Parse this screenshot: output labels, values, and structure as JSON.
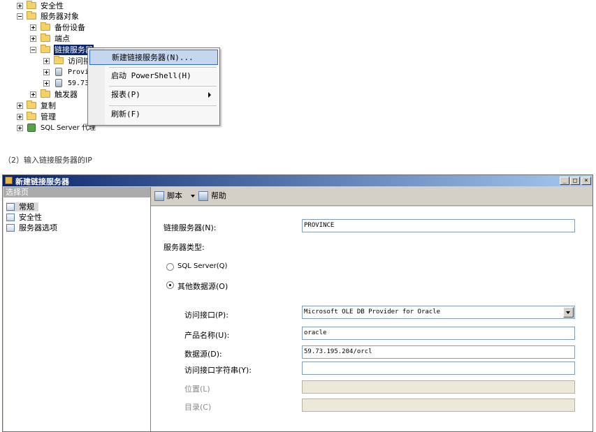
{
  "tree": {
    "security": "安全性",
    "server_objects": "服务器对象",
    "backup_devices": "备份设备",
    "endpoints": "端点",
    "linked_servers": "链接服务器",
    "providers": "访问接",
    "linked_province": "Provi",
    "linked_ip": "59.73",
    "triggers": "触发器",
    "replication": "复制",
    "management": "管理",
    "sql_agent": "SQL Server 代理"
  },
  "context_menu": {
    "items": [
      "新建链接服务器(N)...",
      "启动 PowerShell(H)",
      "报表(P)",
      "刷新(F)"
    ]
  },
  "caption": "（2）输入链接服务器的IP",
  "dialog": {
    "title": "新建链接服务器",
    "window_buttons": [
      "_",
      "□",
      "×"
    ],
    "left_header": "选择页",
    "pages": [
      "常规",
      "安全性",
      "服务器选项"
    ],
    "toolbar": {
      "script": "脚本",
      "help": "帮助"
    },
    "form": {
      "linked_server_label": "链接服务器(N):",
      "linked_server_value": "PROVINCE",
      "server_type_label": "服务器类型:",
      "sql_server_option": "SQL Server(Q)",
      "other_source_option": "其他数据源(O)",
      "provider_label": "访问接口(P):",
      "provider_value": "Microsoft OLE DB Provider for Oracle",
      "product_label": "产品名称(U):",
      "product_value": "oracle",
      "datasource_label": "数据源(D):",
      "datasource_value": "59.73.195.204/orcl",
      "provider_string_label": "访问接口字符串(Y):",
      "provider_string_value": "",
      "location_label": "位置(L)",
      "catalog_label": "目录(C)"
    }
  },
  "colors": {
    "title_start": "#0a246a",
    "title_end": "#a6caf0",
    "menu_selection": "#c5d6ef",
    "dialog_bg": "#d4d0c8"
  }
}
